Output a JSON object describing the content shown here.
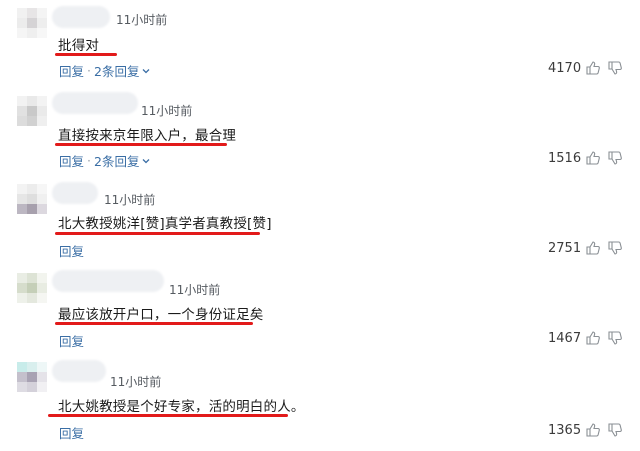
{
  "comments": [
    {
      "time": "11小时前",
      "text": "批得对",
      "reply_label": "回复",
      "replies_label": "2条回复",
      "likes": "4170"
    },
    {
      "time": "11小时前",
      "text": "直接按来京年限入户，最合理",
      "reply_label": "回复",
      "replies_label": "2条回复",
      "likes": "1516"
    },
    {
      "time": "11小时前",
      "text": "北大教授姚洋[赞]真学者真教授[赞]",
      "reply_label": "回复",
      "likes": "2751"
    },
    {
      "time": "11小时前",
      "text": "最应该放开户口，一个身份证足矣",
      "reply_label": "回复",
      "likes": "1467"
    },
    {
      "time": "11小时前",
      "text": "北大姚教授是个好专家，活的明白的人。",
      "reply_label": "回复",
      "likes": "1365"
    }
  ],
  "colors": {
    "underline": "#e21a1a",
    "link": "#3a6ea5"
  },
  "icons": [
    "thumb-up-icon",
    "thumb-down-icon",
    "chevron-down-icon"
  ]
}
